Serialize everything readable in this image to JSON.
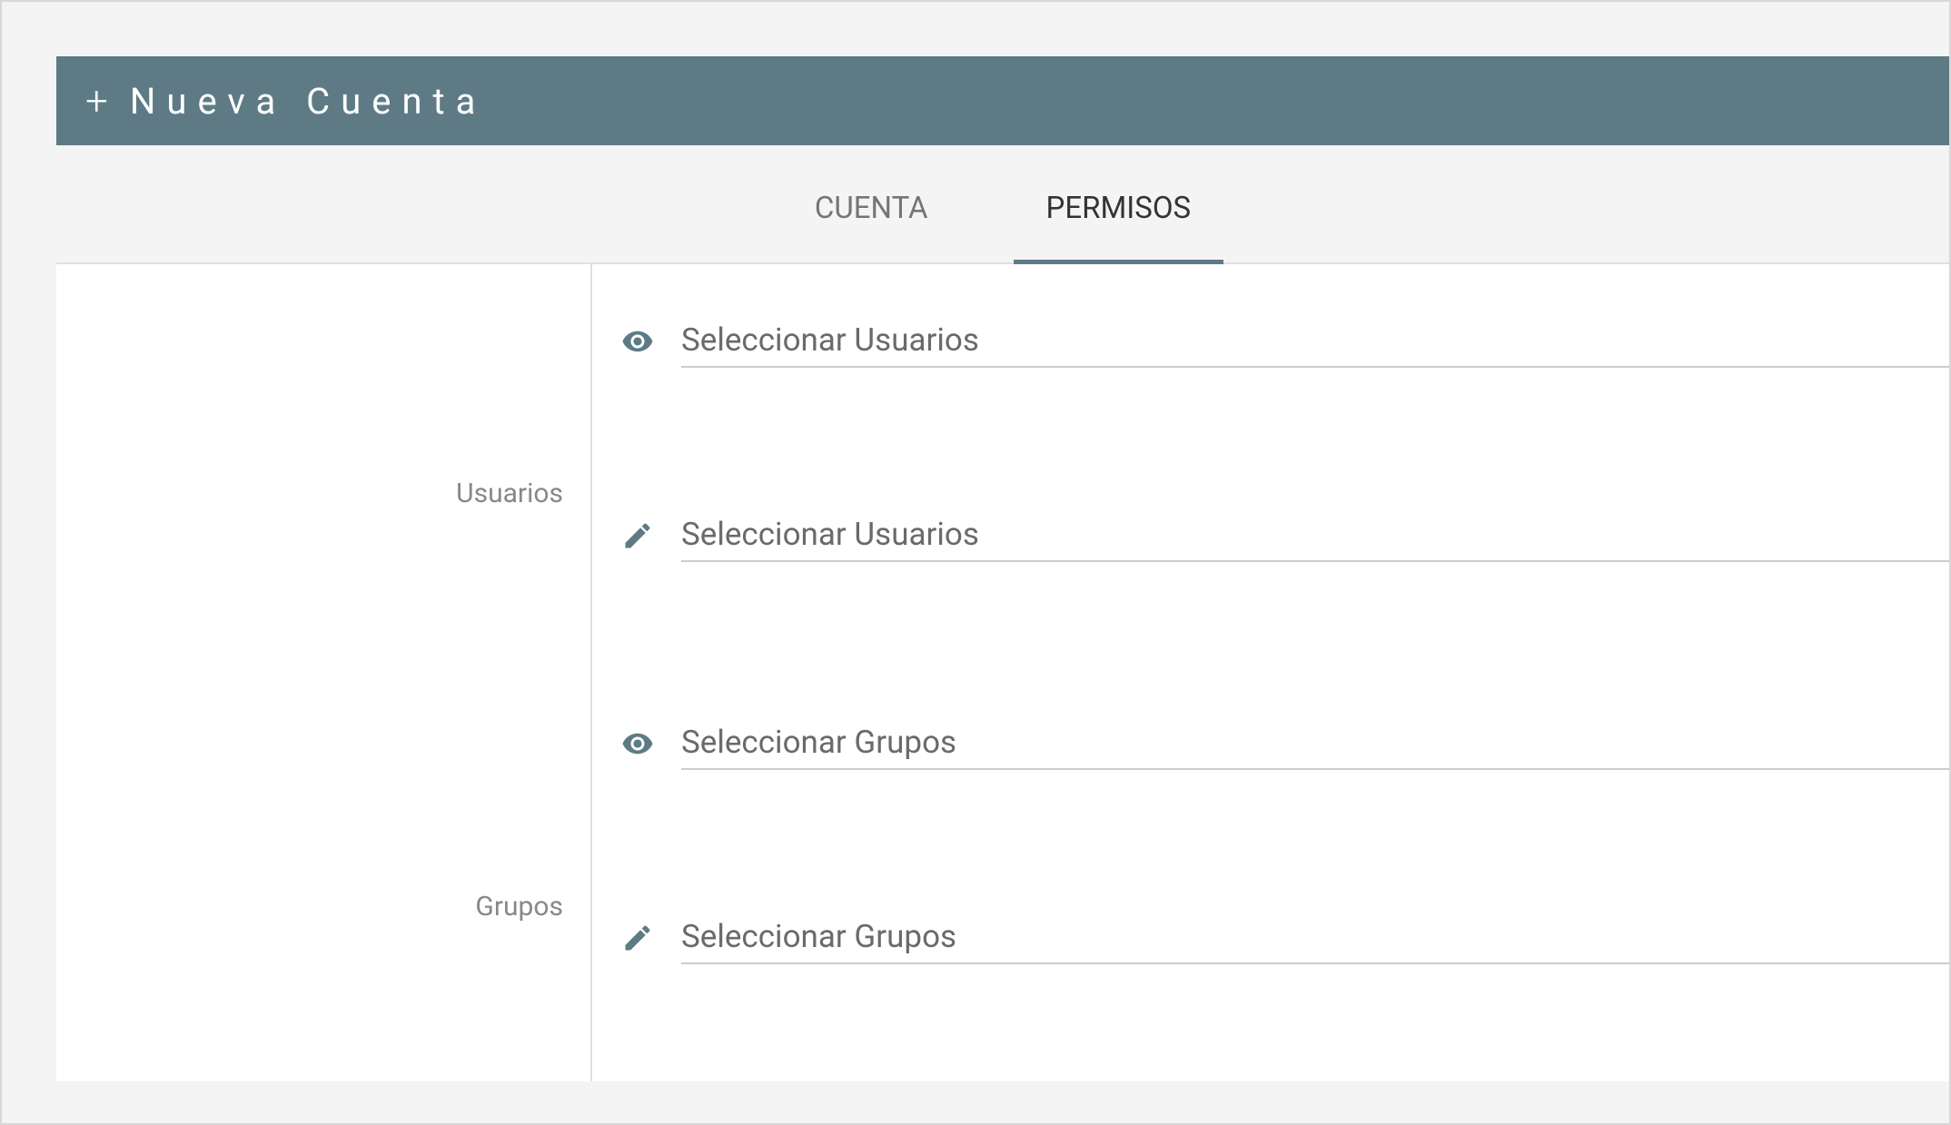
{
  "header": {
    "title": "Nueva Cuenta"
  },
  "tabs": {
    "cuenta": "CUENTA",
    "permisos": "PERMISOS"
  },
  "sidebar": {
    "usuarios": "Usuarios",
    "grupos": "Grupos"
  },
  "form": {
    "usuarios_view_placeholder": "Seleccionar Usuarios",
    "usuarios_edit_placeholder": "Seleccionar Usuarios",
    "grupos_view_placeholder": "Seleccionar Grupos",
    "grupos_edit_placeholder": "Seleccionar Grupos"
  }
}
